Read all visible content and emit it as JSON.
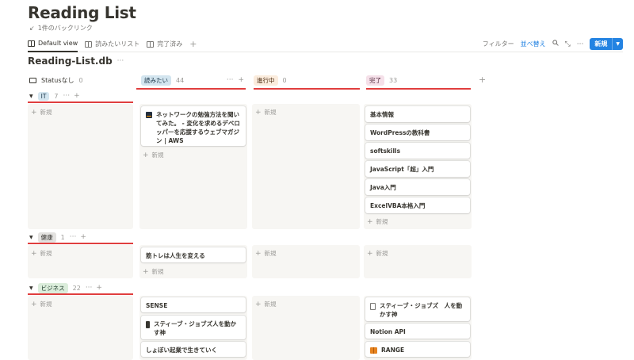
{
  "page": {
    "title": "Reading List",
    "backlink": "1件のバックリンク"
  },
  "views": {
    "tabs": [
      {
        "label": "Default view",
        "active": true
      },
      {
        "label": "読みたいリスト",
        "active": false
      },
      {
        "label": "完了済み",
        "active": false
      }
    ],
    "add": "+"
  },
  "toolbar": {
    "filter": "フィルター",
    "sort": "並べ替え",
    "search_icon": "search-icon",
    "expand_icon": "expand-icon",
    "more": "···",
    "new_label": "新規",
    "new_dropdown": "chevron-down-icon"
  },
  "database": {
    "title": "Reading-List.db",
    "more": "···"
  },
  "columns": [
    {
      "label": "Statusなし",
      "count": "0"
    },
    {
      "label": "読みたい",
      "count": "44",
      "color": "#d3e5ef"
    },
    {
      "label": "進行中",
      "count": "0",
      "color": "#fbecdd"
    },
    {
      "label": "完了",
      "count": "33",
      "color": "#f5e0e9"
    }
  ],
  "column_actions": {
    "more": "···",
    "add": "+"
  },
  "add_new": "新規",
  "groups": [
    {
      "label": "IT",
      "count": "7",
      "color": "#d3e5ef",
      "cards": {
        "want": [
          {
            "title": "ネットワークの勉強方法を聞いてみた。 - 変化を求めるデベロッパーを応援するウェブマガジン | AWS",
            "icon": "aws-icon"
          }
        ],
        "done": [
          {
            "title": "基本情報"
          },
          {
            "title": "WordPressの教科書"
          },
          {
            "title": "softskills"
          },
          {
            "title": "JavaScript「超」入門"
          },
          {
            "title": "Java入門"
          },
          {
            "title": "ExcelVBA本格入門"
          }
        ]
      }
    },
    {
      "label": "健康",
      "count": "1",
      "color": "#e3e2e0",
      "cards": {
        "want": [
          {
            "title": "筋トレは人生を変える"
          }
        ],
        "done": []
      }
    },
    {
      "label": "ビジネス",
      "count": "22",
      "color": "#dbeddb",
      "cards": {
        "want": [
          {
            "title": "SENSE"
          },
          {
            "title": "スティーブ・ジョブズ人を動かす神",
            "icon": "book-icon"
          },
          {
            "title": "しょぼい起業で生きていく"
          }
        ],
        "done": [
          {
            "title": "スティーブ・ジョブズ　人を動かす神",
            "icon": "document-icon"
          },
          {
            "title": "Notion API"
          },
          {
            "title": "RANGE",
            "icon": "book-icon"
          }
        ]
      }
    }
  ],
  "colors": {
    "accent": "#2383e2",
    "annotation_red": "#e03e3e",
    "lane_bg": "#f7f6f3"
  }
}
